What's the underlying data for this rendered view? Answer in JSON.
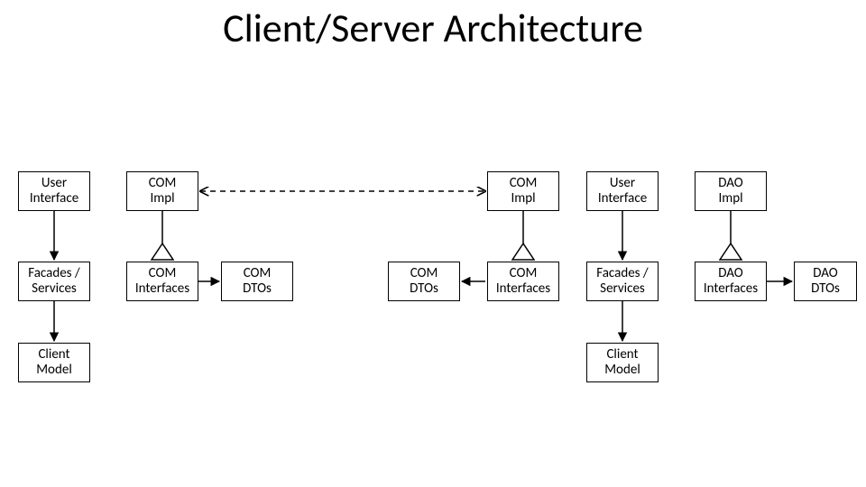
{
  "title": "Client/Server Architecture",
  "boxes": {
    "ui_left": "User\nInterface",
    "com_impl_left": "COM\nImpl",
    "com_impl_right": "COM\nImpl",
    "ui_right": "User\nInterface",
    "dao_impl": "DAO\nImpl",
    "facades_left": "Facades /\nServices",
    "com_if_left": "COM\nInterfaces",
    "com_dtos_left": "COM\nDTOs",
    "com_dtos_right": "COM\nDTOs",
    "com_if_right": "COM\nInterfaces",
    "facades_right": "Facades /\nServices",
    "dao_if": "DAO\nInterfaces",
    "dao_dtos": "DAO\nDTOs",
    "client_model_left": "Client\nModel",
    "client_model_right": "Client\nModel"
  },
  "chart_data": {
    "type": "diagram",
    "title": "Client/Server Architecture",
    "nodes": [
      {
        "id": "ui_left",
        "label": "User Interface",
        "row": 0,
        "col": 0
      },
      {
        "id": "com_impl_left",
        "label": "COM Impl",
        "row": 0,
        "col": 1
      },
      {
        "id": "com_impl_right",
        "label": "COM Impl",
        "row": 0,
        "col": 4
      },
      {
        "id": "ui_right",
        "label": "User Interface",
        "row": 0,
        "col": 5
      },
      {
        "id": "dao_impl",
        "label": "DAO Impl",
        "row": 0,
        "col": 6
      },
      {
        "id": "facades_left",
        "label": "Facades / Services",
        "row": 1,
        "col": 0
      },
      {
        "id": "com_if_left",
        "label": "COM Interfaces",
        "row": 1,
        "col": 1
      },
      {
        "id": "com_dtos_left",
        "label": "COM DTOs",
        "row": 1,
        "col": 2
      },
      {
        "id": "com_dtos_right",
        "label": "COM DTOs",
        "row": 1,
        "col": 3
      },
      {
        "id": "com_if_right",
        "label": "COM Interfaces",
        "row": 1,
        "col": 4
      },
      {
        "id": "facades_right",
        "label": "Facades / Services",
        "row": 1,
        "col": 5
      },
      {
        "id": "dao_if",
        "label": "DAO Interfaces",
        "row": 1,
        "col": 6
      },
      {
        "id": "dao_dtos",
        "label": "DAO DTOs",
        "row": 1,
        "col": 7
      },
      {
        "id": "client_model_left",
        "label": "Client Model",
        "row": 2,
        "col": 0
      },
      {
        "id": "client_model_right",
        "label": "Client Model",
        "row": 2,
        "col": 5
      }
    ],
    "edges": [
      {
        "from": "ui_left",
        "to": "facades_left",
        "style": "solid-arrow"
      },
      {
        "from": "facades_left",
        "to": "client_model_left",
        "style": "solid-arrow"
      },
      {
        "from": "com_impl_left",
        "to": "com_if_left",
        "style": "realization"
      },
      {
        "from": "com_if_left",
        "to": "com_dtos_left",
        "style": "solid-arrow"
      },
      {
        "from": "com_impl_left",
        "to": "com_impl_right",
        "style": "dashed-bidir"
      },
      {
        "from": "com_impl_right",
        "to": "com_if_right",
        "style": "realization"
      },
      {
        "from": "com_dtos_right",
        "to": "com_if_right",
        "style": "solid-arrow-left"
      },
      {
        "from": "ui_right",
        "to": "facades_right",
        "style": "solid-arrow"
      },
      {
        "from": "facades_right",
        "to": "client_model_right",
        "style": "solid-arrow"
      },
      {
        "from": "dao_impl",
        "to": "dao_if",
        "style": "realization"
      },
      {
        "from": "dao_if",
        "to": "dao_dtos",
        "style": "solid-arrow"
      }
    ]
  }
}
